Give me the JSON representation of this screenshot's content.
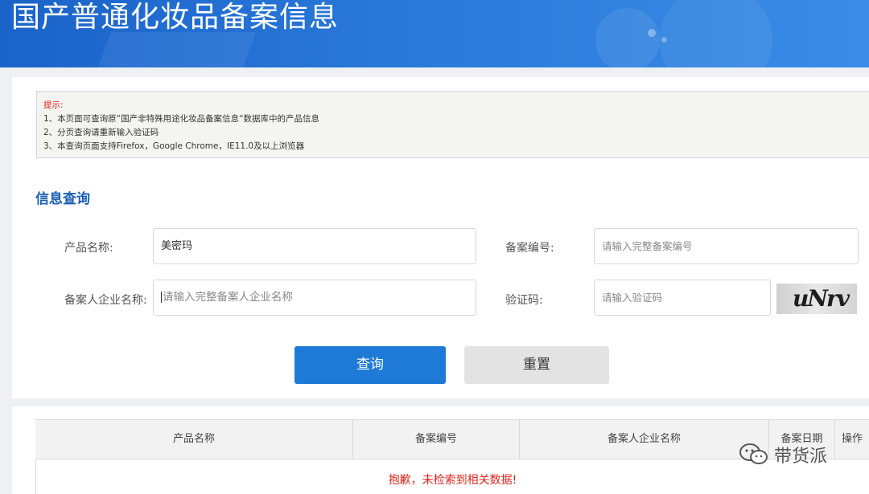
{
  "header": {
    "title": "国产普通化妆品备案信息"
  },
  "notice": {
    "tip_label": "提示:",
    "lines": [
      "1、本页面可查询原“国产非特殊用途化妆品备案信息“数据库中的产品信息",
      "2、分页查询请重新输入验证码",
      "3、本查询页面支持Firefox，Google Chrome，IE11.0及以上浏览器"
    ]
  },
  "form": {
    "section_title": "信息查询",
    "product_name": {
      "label": "产品名称:",
      "value": "美密玛"
    },
    "record_no": {
      "label": "备案编号:",
      "placeholder": "请输入完整备案编号"
    },
    "company_name": {
      "label": "备案人企业名称:",
      "placeholder": "请输入完整备案人企业名称"
    },
    "captcha": {
      "label": "验证码:",
      "placeholder": "请输入验证码",
      "image_text": "uNrv"
    },
    "query_button": "查询",
    "reset_button": "重置"
  },
  "results": {
    "columns": [
      "产品名称",
      "备案编号",
      "备案人企业名称",
      "备案日期",
      "操作"
    ],
    "empty_message": "抱歉，未检索到相关数据!"
  },
  "watermark": {
    "text": "带货派"
  },
  "colors": {
    "header_blue": "#1a63c9",
    "accent_blue": "#1e7ad6",
    "tip_red": "#e0241b",
    "section_blue": "#1a5fb4"
  }
}
